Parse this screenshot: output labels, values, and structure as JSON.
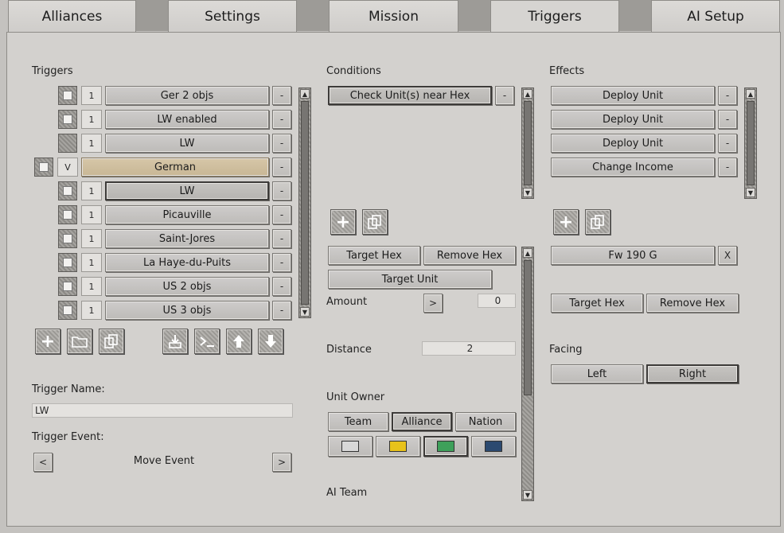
{
  "tabs": [
    "Alliances",
    "Settings",
    "Mission",
    "Triggers",
    "AI Setup"
  ],
  "triggers": {
    "heading": "Triggers",
    "minus": "-",
    "rows": [
      {
        "num": "1",
        "name": "Ger 2 objs"
      },
      {
        "num": "1",
        "name": "LW enabled"
      },
      {
        "num": "1",
        "name": "LW"
      },
      {
        "num": "V",
        "name": "German"
      },
      {
        "num": "1",
        "name": "LW"
      },
      {
        "num": "1",
        "name": "Picauville"
      },
      {
        "num": "1",
        "name": "Saint-Jores"
      },
      {
        "num": "1",
        "name": "La Haye-du-Puits"
      },
      {
        "num": "1",
        "name": "US 2 objs"
      },
      {
        "num": "1",
        "name": "US 3 objs"
      }
    ],
    "name_label": "Trigger Name:",
    "name_value": "LW",
    "event_label": "Trigger Event:",
    "event_value": "Move Event",
    "prev": "<",
    "next": ">"
  },
  "conditions": {
    "heading": "Conditions",
    "items": [
      "Check Unit(s) near Hex"
    ],
    "minus": "-",
    "target_hex": "Target Hex",
    "remove_hex": "Remove Hex",
    "target_unit": "Target Unit",
    "amount_label": "Amount",
    "amount_op": ">",
    "amount_value": "0",
    "distance_label": "Distance",
    "distance_value": "2",
    "owner_label": "Unit Owner",
    "owner_tabs": [
      "Team",
      "Alliance",
      "Nation"
    ],
    "colors": [
      "#d8d8d8",
      "#e8c21a",
      "#3ea05a",
      "#2c4a70"
    ],
    "ai_team_label": "AI Team"
  },
  "effects": {
    "heading": "Effects",
    "items": [
      "Deploy Unit",
      "Deploy Unit",
      "Deploy Unit",
      "Change Income"
    ],
    "minus": "-",
    "unit": "Fw 190 G",
    "unit_remove": "X",
    "target_hex": "Target Hex",
    "remove_hex": "Remove Hex",
    "facing_label": "Facing",
    "facing_left": "Left",
    "facing_right": "Right"
  }
}
